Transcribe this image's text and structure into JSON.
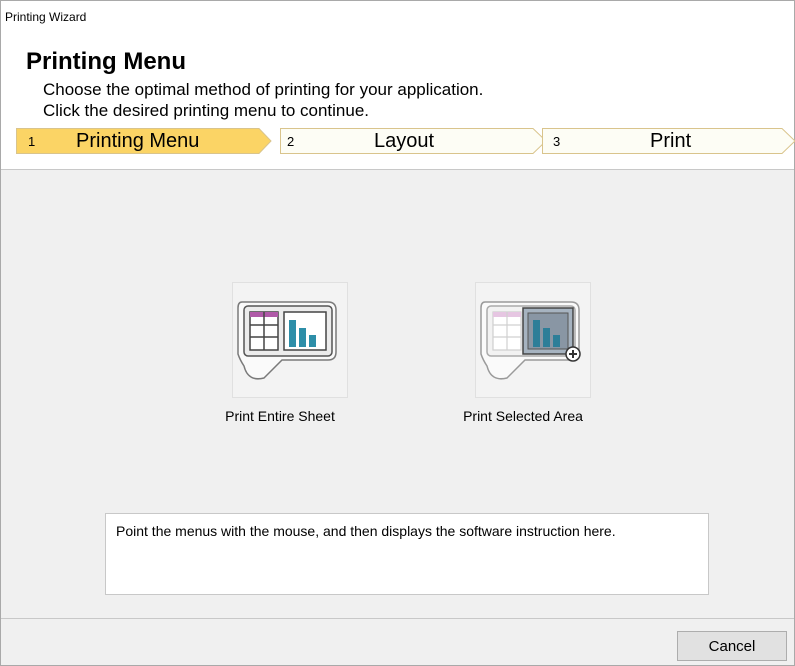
{
  "window": {
    "title": "Printing Wizard"
  },
  "header": {
    "title": "Printing Menu",
    "subtitle_line1": "Choose the optimal method of printing for your application.",
    "subtitle_line2": "Click the desired printing menu to continue."
  },
  "steps": [
    {
      "number": "1",
      "label": "Printing Menu",
      "active": true
    },
    {
      "number": "2",
      "label": "Layout",
      "active": false
    },
    {
      "number": "3",
      "label": "Print",
      "active": false
    }
  ],
  "options": [
    {
      "label": "Print Entire Sheet",
      "icon": "print-entire-sheet-icon"
    },
    {
      "label": "Print Selected Area",
      "icon": "print-selected-area-icon"
    }
  ],
  "instructions": "Point the menus with the mouse, and then displays the software instruction here.",
  "footer": {
    "cancel_label": "Cancel"
  },
  "colors": {
    "active_step": "#fbd465",
    "inactive_step": "#fdfdf5",
    "step_border": "#d9c48c"
  }
}
